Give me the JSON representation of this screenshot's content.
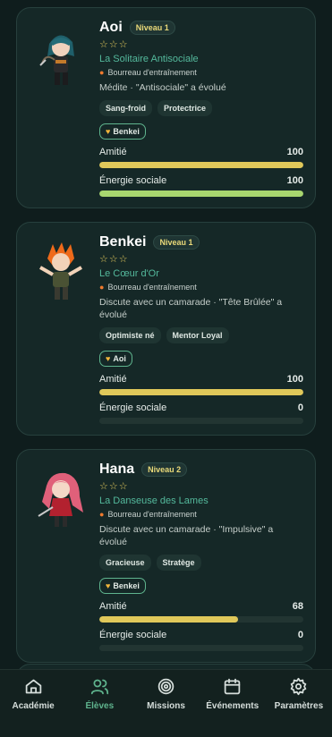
{
  "students": [
    {
      "name": "Aoi",
      "level": "Niveau 1",
      "stars": "☆☆☆",
      "title": "La Solitaire Antisociale",
      "trait": "Bourreau d'entraînement",
      "activity": "Médite · \"Antisociale\" a évolué",
      "tags": [
        "Sang-froid",
        "Protectrice"
      ],
      "friend": "Benkei",
      "friendship_label": "Amitié",
      "friendship_value": "100",
      "friendship_percent": 100,
      "energy_label": "Énergie sociale",
      "energy_value": "100",
      "energy_percent": 100
    },
    {
      "name": "Benkei",
      "level": "Niveau 1",
      "stars": "☆☆☆",
      "title": "Le Cœur d'Or",
      "trait": "Bourreau d'entraînement",
      "activity": "Discute avec un camarade · \"Tête Brûlée\" a évolué",
      "tags": [
        "Optimiste né",
        "Mentor Loyal"
      ],
      "friend": "Aoi",
      "friendship_label": "Amitié",
      "friendship_value": "100",
      "friendship_percent": 100,
      "energy_label": "Énergie sociale",
      "energy_value": "0",
      "energy_percent": 0
    },
    {
      "name": "Hana",
      "level": "Niveau 2",
      "stars": "☆☆☆",
      "title": "La Danseuse des Lames",
      "trait": "Bourreau d'entraînement",
      "activity": "Discute avec un camarade · \"Impulsive\" a évolué",
      "tags": [
        "Gracieuse",
        "Stratège"
      ],
      "friend": "Benkei",
      "friendship_label": "Amitié",
      "friendship_value": "68",
      "friendship_percent": 68,
      "energy_label": "Énergie sociale",
      "energy_value": "0",
      "energy_percent": 0
    }
  ],
  "nav": {
    "items": [
      {
        "label": "Académie",
        "icon": "home-icon"
      },
      {
        "label": "Élèves",
        "icon": "users-icon"
      },
      {
        "label": "Missions",
        "icon": "target-icon"
      },
      {
        "label": "Événements",
        "icon": "calendar-icon"
      },
      {
        "label": "Paramètres",
        "icon": "gear-icon"
      }
    ],
    "active_index": 1
  },
  "colors": {
    "background": "#0f1d1d",
    "card": "#152827",
    "accent": "#5fb48e",
    "friendship_bar": "#e0c85a",
    "energy_bar": "#a8d66f",
    "level_text": "#e9d979"
  }
}
